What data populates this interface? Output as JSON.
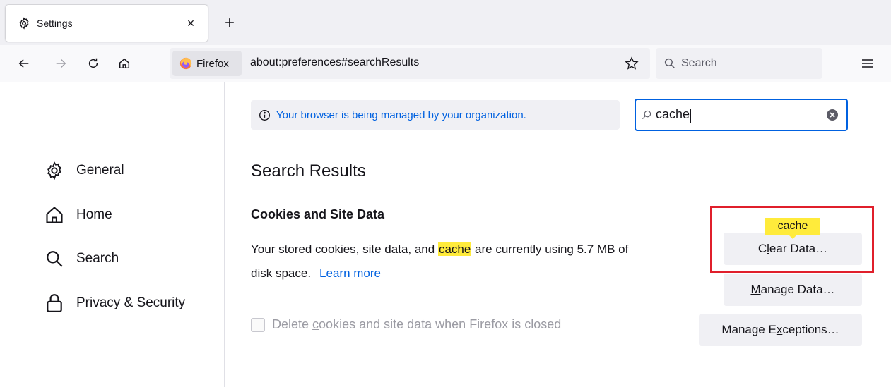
{
  "tab": {
    "title": "Settings",
    "icon": "gear-icon",
    "close_glyph": "×"
  },
  "newtab": {
    "glyph": "+"
  },
  "nav": {
    "identity_label": "Firefox",
    "url": "about:preferences#searchResults",
    "search_placeholder": "Search"
  },
  "sidebar": {
    "items": [
      {
        "label": "General",
        "icon": "gear-icon"
      },
      {
        "label": "Home",
        "icon": "home-icon"
      },
      {
        "label": "Search",
        "icon": "search-icon"
      },
      {
        "label": "Privacy & Security",
        "icon": "lock-icon"
      }
    ]
  },
  "managed_notice": "Your browser is being managed by your organization.",
  "pref_search": {
    "query": "cache"
  },
  "results_title": "Search Results",
  "cookies": {
    "title": "Cookies and Site Data",
    "desc_before": "Your stored cookies, site data, and ",
    "desc_highlight": "cache",
    "desc_after": " are currently using 5.7 MB of",
    "desc_line2": "disk space.",
    "learn_more": "Learn more",
    "checkbox_prefix": "Delete ",
    "checkbox_access": "c",
    "checkbox_suffix": "ookies and site data when Firefox is closed",
    "tooltip": "cache"
  },
  "buttons": {
    "clear_data": {
      "pre": "C",
      "access": "l",
      "post": "ear Data…"
    },
    "manage_data": {
      "pre": "",
      "access": "M",
      "post": "anage Data…"
    },
    "manage_exceptions": {
      "pre": "Manage E",
      "access": "x",
      "post": "ceptions…"
    }
  },
  "colors": {
    "accent": "#0061e0",
    "highlight": "#ffeb3b",
    "annotation_red": "#e01f2b"
  }
}
